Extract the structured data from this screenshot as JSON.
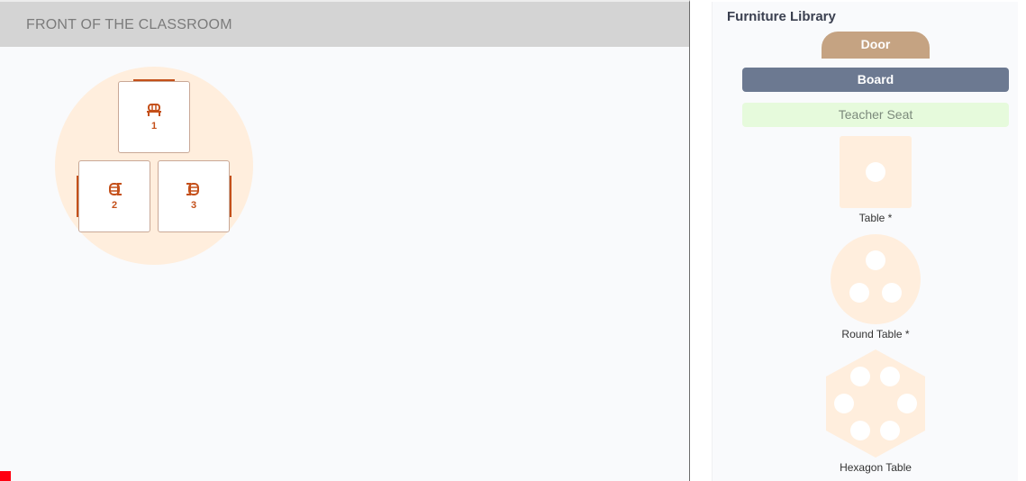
{
  "classroom": {
    "front_label": "FRONT OF THE CLASSROOM",
    "group": {
      "type": "round-table",
      "seats": [
        {
          "number": "1",
          "facing": "up"
        },
        {
          "number": "2",
          "facing": "left"
        },
        {
          "number": "3",
          "facing": "right"
        }
      ]
    }
  },
  "library": {
    "title": "Furniture Library",
    "door_label": "Door",
    "board_label": "Board",
    "teacher_label": "Teacher Seat",
    "table_label": "Table *",
    "round_table_label": "Round Table *",
    "hexagon_table_label": "Hexagon Table"
  },
  "icons": {
    "seat": "chair-icon"
  },
  "colors": {
    "accent": "#c4501a",
    "table_fill": "#ffeedd",
    "door": "#c5a382",
    "board": "#6c7991",
    "teacher": "#e6fadc",
    "front_bar": "#d4d4d4",
    "marker": "#ff0010"
  }
}
